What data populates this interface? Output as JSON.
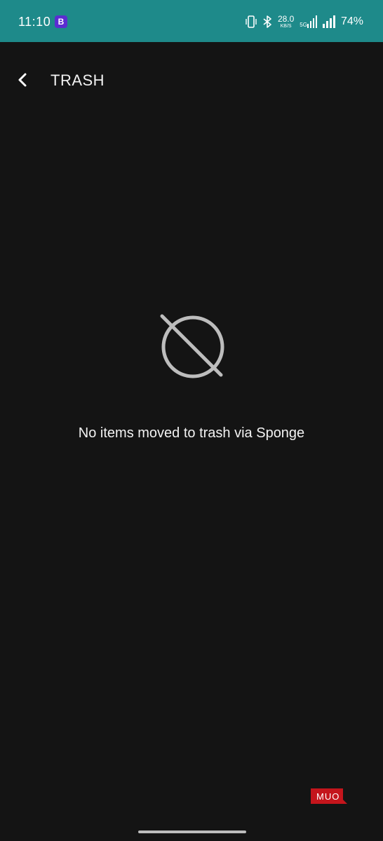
{
  "status_bar": {
    "time": "11:10",
    "app_badge": "B",
    "net_speed_value": "28.0",
    "net_speed_unit": "KB/S",
    "network_type": "5G",
    "battery": "74%",
    "colors": {
      "background": "#1e8a8a",
      "badge": "#5b2dd1"
    }
  },
  "header": {
    "title": "TRASH",
    "back_icon": "chevron-left-icon"
  },
  "empty_state": {
    "icon": "no-items-icon",
    "message": "No items moved to trash via Sponge"
  },
  "watermark": {
    "text": "MUO",
    "color": "#c4151c"
  },
  "theme": {
    "background": "#141414",
    "text": "#f2f2f2",
    "icon": "#bdbdbd"
  }
}
